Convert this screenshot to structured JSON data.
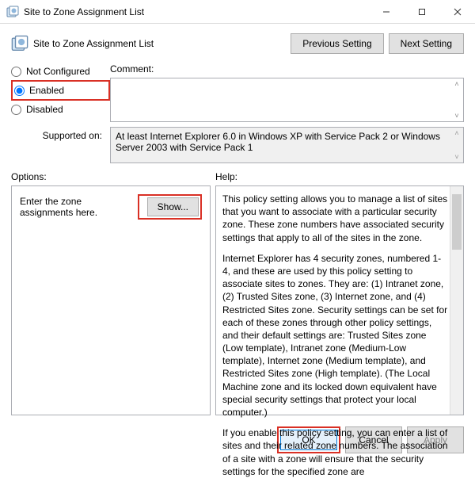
{
  "window": {
    "title": "Site to Zone Assignment List"
  },
  "header": {
    "title": "Site to Zone Assignment List",
    "prev_btn": "Previous Setting",
    "next_btn": "Next Setting"
  },
  "radios": {
    "not_configured": "Not Configured",
    "enabled": "Enabled",
    "disabled": "Disabled",
    "selected": "enabled"
  },
  "comment": {
    "label": "Comment:",
    "value": ""
  },
  "supported": {
    "label": "Supported on:",
    "text": "At least Internet Explorer 6.0 in Windows XP with Service Pack 2 or Windows Server 2003 with Service Pack 1"
  },
  "sections": {
    "options_label": "Options:",
    "help_label": "Help:"
  },
  "options": {
    "prompt": "Enter the zone assignments here.",
    "show_btn": "Show..."
  },
  "help": {
    "p1": "This policy setting allows you to manage a list of sites that you want to associate with a particular security zone. These zone numbers have associated security settings that apply to all of the sites in the zone.",
    "p2": "Internet Explorer has 4 security zones, numbered 1-4, and these are used by this policy setting to associate sites to zones. They are: (1) Intranet zone, (2) Trusted Sites zone, (3) Internet zone, and (4) Restricted Sites zone. Security settings can be set for each of these zones through other policy settings, and their default settings are: Trusted Sites zone (Low template), Intranet zone (Medium-Low template), Internet zone (Medium template), and Restricted Sites zone (High template). (The Local Machine zone and its locked down equivalent have special security settings that protect your local computer.)",
    "p3": "If you enable this policy setting, you can enter a list of sites and their related zone numbers. The association of a site with a zone will ensure that the security settings for the specified zone are"
  },
  "footer": {
    "ok": "OK",
    "cancel": "Cancel",
    "apply": "Apply"
  }
}
